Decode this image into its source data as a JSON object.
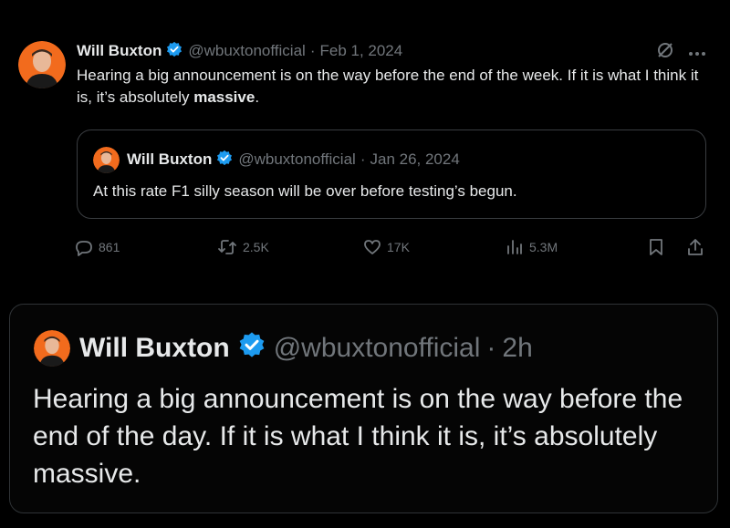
{
  "tweet1": {
    "name": "Will Buxton",
    "handle": "@wbuxtonofficial",
    "separator": "·",
    "date": "Feb 1, 2024",
    "text_before_bold": "Hearing a big announcement is on the way before the end of the week. If it is what I think it is, it’s absolutely ",
    "text_bold": "massive",
    "text_after_bold": ".",
    "quote": {
      "name": "Will Buxton",
      "handle": "@wbuxtonofficial",
      "separator": "·",
      "date": "Jan 26, 2024",
      "text": "At this rate F1 silly season will be over before testing’s begun."
    },
    "metrics": {
      "replies": "861",
      "retweets": "2.5K",
      "likes": "17K",
      "views": "5.3M"
    },
    "icons": [
      "grok-icon",
      "more-icon",
      "reply-icon",
      "retweet-icon",
      "like-icon",
      "views-icon",
      "bookmark-icon",
      "share-icon"
    ]
  },
  "tweet2": {
    "name": "Will Buxton",
    "handle": "@wbuxtonofficial",
    "separator": "·",
    "time": "2h",
    "text": "Hearing a big announcement is on the way before the end of the day. If it is what I think it is, it’s absolutely massive."
  },
  "colors": {
    "background": "#000000",
    "text": "#e7e9ea",
    "secondary": "#71767b",
    "verified": "#1d9bf0",
    "border": "#3a3d41",
    "avatar_bg": "#f26b1d"
  }
}
